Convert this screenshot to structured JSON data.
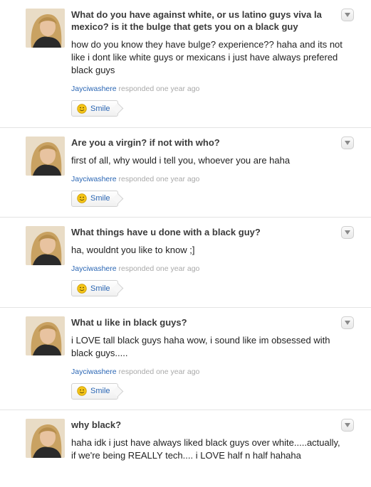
{
  "items": [
    {
      "question": "What do you have against white, or us latino guys viva la mexico? is it the bulge that gets you on a black guy",
      "answer": "how do you know they have bulge? experience?? haha and its not like i dont like white guys or mexicans i just have always prefered black guys",
      "user": "Jayciwashere",
      "responded": "responded one year ago",
      "smile_label": "Smile"
    },
    {
      "question": "Are you a virgin? if not with who?",
      "answer": "first of all, why would i tell you, whoever you are haha",
      "user": "Jayciwashere",
      "responded": "responded one year ago",
      "smile_label": "Smile"
    },
    {
      "question": "What things have u done with a black guy?",
      "answer": "ha, wouldnt you like to know ;]",
      "user": "Jayciwashere",
      "responded": "responded one year ago",
      "smile_label": "Smile"
    },
    {
      "question": "What u like in black guys?",
      "answer": "i LOVE tall black guys haha wow, i sound like im obsessed with black guys.....",
      "user": "Jayciwashere",
      "responded": "responded one year ago",
      "smile_label": "Smile"
    },
    {
      "question": "why black?",
      "answer": "haha idk i just have always liked black guys over white.....actually, if we're being REALLY tech.... i LOVE half n half hahaha"
    }
  ],
  "icons": {
    "avatar": "profile-photo",
    "menu": "chevron-down-icon",
    "smile": "smiley-face-icon"
  },
  "colors": {
    "link": "#2a66b4",
    "meta": "#a9a9a9",
    "smiley": "#f5c518"
  }
}
